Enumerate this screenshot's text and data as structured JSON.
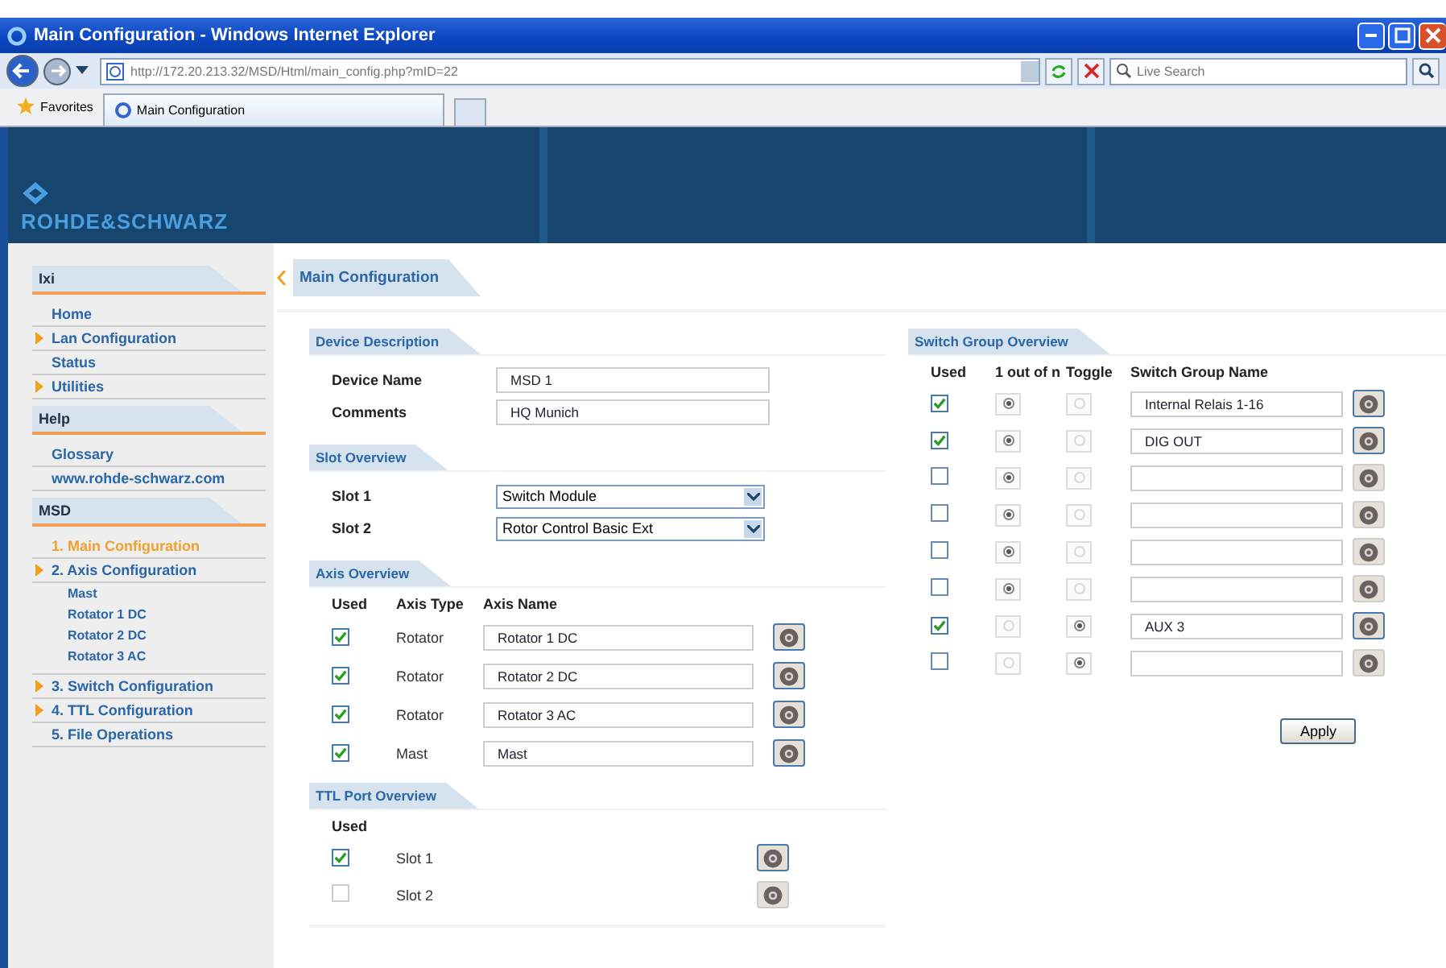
{
  "window": {
    "title": "Main Configuration - Windows Internet Explorer"
  },
  "browser": {
    "address": "http://172.20.213.32/MSD/Html/main_config.php?mID=22",
    "search_placeholder": "Live Search",
    "favorites": "Favorites",
    "tabs": [
      {
        "label": "Main Configuration",
        "selected": true
      }
    ]
  },
  "banner": {
    "logo": "ROHDE&SCHWARZ"
  },
  "sidebar": [
    {
      "title": "Ixi",
      "items": [
        {
          "label": "Home",
          "expandable": false,
          "selected": false
        },
        {
          "label": "Lan Configuration",
          "expandable": true,
          "selected": false
        },
        {
          "label": "Status",
          "expandable": false,
          "selected": false
        },
        {
          "label": "Utilities",
          "expandable": true,
          "selected": false
        }
      ]
    },
    {
      "title": "Help",
      "items": [
        {
          "label": "Glossary",
          "expandable": false,
          "selected": false
        },
        {
          "label": "www.rohde-schwarz.com",
          "expandable": false,
          "selected": false
        }
      ]
    },
    {
      "title": "MSD",
      "items": [
        {
          "label": "1. Main Configuration",
          "expandable": false,
          "selected": true
        },
        {
          "label": "2. Axis Configuration",
          "expandable": true,
          "selected": false,
          "children": [
            {
              "label": "Mast"
            },
            {
              "label": "Rotator 1 DC"
            },
            {
              "label": "Rotator 2 DC"
            },
            {
              "label": "Rotator 3 AC"
            }
          ]
        },
        {
          "label": "3. Switch Configuration",
          "expandable": true,
          "selected": false
        },
        {
          "label": "4. TTL Configuration",
          "expandable": true,
          "selected": false
        },
        {
          "label": "5. File Operations",
          "expandable": false,
          "selected": false
        }
      ]
    }
  ],
  "page_title": "Main Configuration",
  "device_description": {
    "title": "Device Description",
    "fields": [
      {
        "label": "Device Name",
        "value": "MSD 1"
      },
      {
        "label": "Comments",
        "value": "HQ Munich"
      }
    ]
  },
  "slot_overview": {
    "title": "Slot Overview",
    "fields": [
      {
        "label": "Slot 1",
        "value": "Switch Module"
      },
      {
        "label": "Slot 2",
        "value": "Rotor Control Basic Ext"
      }
    ]
  },
  "axis_overview": {
    "title": "Axis Overview",
    "columns": [
      "Used",
      "Axis Type",
      "Axis Name"
    ],
    "rows": [
      {
        "used": true,
        "type": "Rotator",
        "name": "Rotator 1 DC"
      },
      {
        "used": true,
        "type": "Rotator",
        "name": "Rotator 2 DC"
      },
      {
        "used": true,
        "type": "Rotator",
        "name": "Rotator 3 AC"
      },
      {
        "used": true,
        "type": "Mast",
        "name": "Mast"
      }
    ]
  },
  "ttl_port_overview": {
    "title": "TTL Port Overview",
    "columns": [
      "Used"
    ],
    "rows": [
      {
        "used": true,
        "label": "Slot 1"
      },
      {
        "used": false,
        "label": "Slot 2"
      }
    ]
  },
  "switch_group_overview": {
    "title": "Switch Group Overview",
    "columns": [
      "Used",
      "1 out of n",
      "Toggle",
      "Switch Group Name"
    ],
    "rows": [
      {
        "used": true,
        "one_out_of_n": true,
        "toggle": false,
        "name": "Internal Relais 1-16"
      },
      {
        "used": true,
        "one_out_of_n": true,
        "toggle": false,
        "name": "DIG OUT"
      },
      {
        "used": false,
        "one_out_of_n": true,
        "toggle": false
      },
      {
        "used": false,
        "one_out_of_n": true,
        "toggle": false
      },
      {
        "used": false,
        "one_out_of_n": true,
        "toggle": false
      },
      {
        "used": false,
        "one_out_of_n": true,
        "toggle": false
      },
      {
        "used": true,
        "one_out_of_n": false,
        "toggle": true,
        "name": "AUX 3"
      },
      {
        "used": false,
        "one_out_of_n": false,
        "toggle": true
      }
    ]
  },
  "apply_button": "Apply"
}
